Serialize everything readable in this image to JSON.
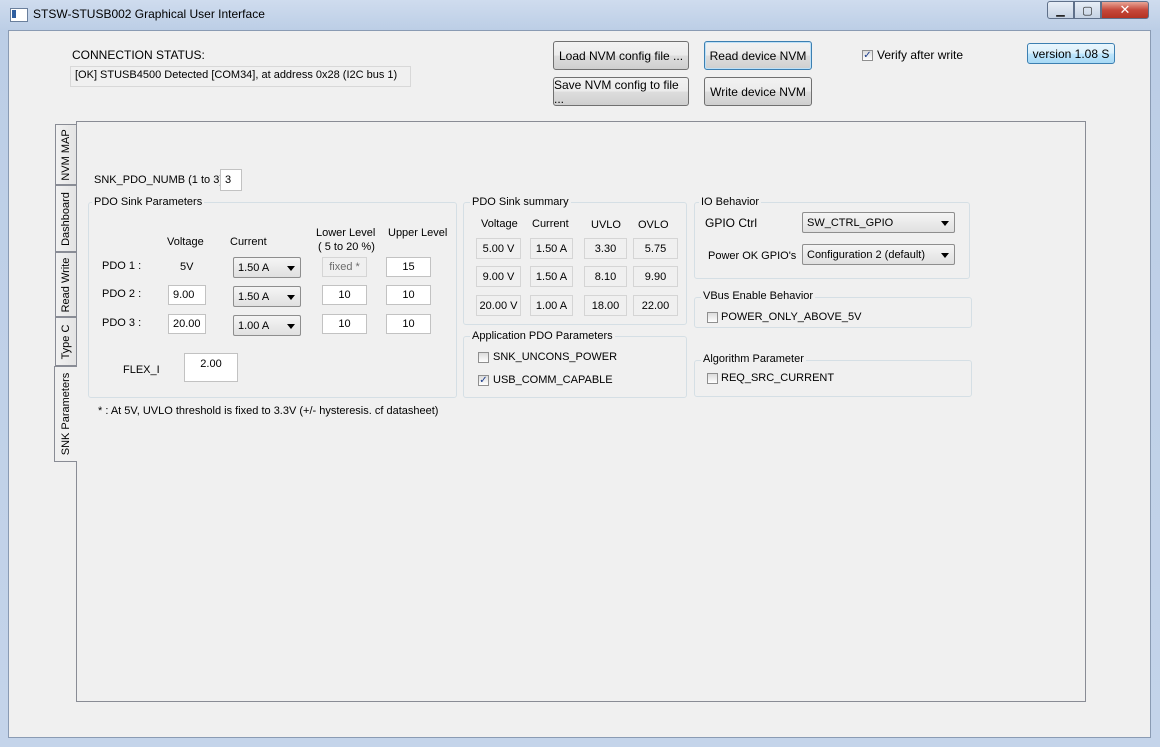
{
  "window": {
    "title": "STSW-STUSB002 Graphical User Interface",
    "controls": {
      "minimize": "▁",
      "maximize": "▢",
      "close": "✕"
    }
  },
  "header": {
    "connection_label": "CONNECTION STATUS:",
    "connection_value": "[OK]  STUSB4500 Detected [COM34], at address 0x28 (I2C bus 1)",
    "load_btn": "Load NVM config file ...",
    "save_btn": "Save NVM config to file ...",
    "read_btn": "Read device NVM",
    "write_btn": "Write device NVM",
    "verify_label": "Verify after write",
    "verify_checked": "✓",
    "version_btn": "version 1.08 S"
  },
  "tabs": [
    "NVM MAP",
    "Dashboard",
    "Read Write",
    "Type C",
    "SNK Parameters"
  ],
  "snk": {
    "numb_label": "SNK_PDO_NUMB (1 to 3)",
    "numb_value": "3",
    "params_title": "PDO Sink Parameters",
    "col_voltage": "Voltage",
    "col_current": "Current",
    "col_lower_1": "Lower Level",
    "col_lower_2": "( 5 to 20 %)",
    "col_upper": "Upper Level",
    "rows": [
      {
        "label": "PDO 1 :",
        "voltage": "5V",
        "current": "1.50 A",
        "lower": "fixed *",
        "upper": "15"
      },
      {
        "label": "PDO 2 :",
        "voltage": "9.00",
        "current": "1.50 A",
        "lower": "10",
        "upper": "10"
      },
      {
        "label": "PDO 3 :",
        "voltage": "20.00",
        "current": "1.00 A",
        "lower": "10",
        "upper": "10"
      }
    ],
    "flex_label": "FLEX_I",
    "flex_value": "2.00",
    "footnote": "* : At 5V, UVLO threshold is fixed to 3.3V (+/- hysteresis. cf datasheet)"
  },
  "summary": {
    "title": "PDO Sink summary",
    "headers": [
      "Voltage",
      "Current",
      "UVLO",
      "OVLO"
    ],
    "rows": [
      [
        "5.00 V",
        "1.50 A",
        "3.30",
        "5.75"
      ],
      [
        "9.00 V",
        "1.50 A",
        "8.10",
        "9.90"
      ],
      [
        "20.00 V",
        "1.00 A",
        "18.00",
        "22.00"
      ]
    ]
  },
  "app_params": {
    "title": "Application PDO Parameters",
    "uncons_label": "SNK_UNCONS_POWER",
    "usbcomm_label": "USB_COMM_CAPABLE",
    "usbcomm_checked": "✓"
  },
  "io": {
    "title": "IO Behavior",
    "gpio_label": "GPIO Ctrl",
    "gpio_value": "SW_CTRL_GPIO",
    "powerok_label": "Power OK GPIO's",
    "powerok_value": "Configuration 2 (default)"
  },
  "vbus": {
    "title": "VBus Enable Behavior",
    "label": "POWER_ONLY_ABOVE_5V"
  },
  "algo": {
    "title": "Algorithm Parameter",
    "label": "REQ_SRC_CURRENT"
  }
}
